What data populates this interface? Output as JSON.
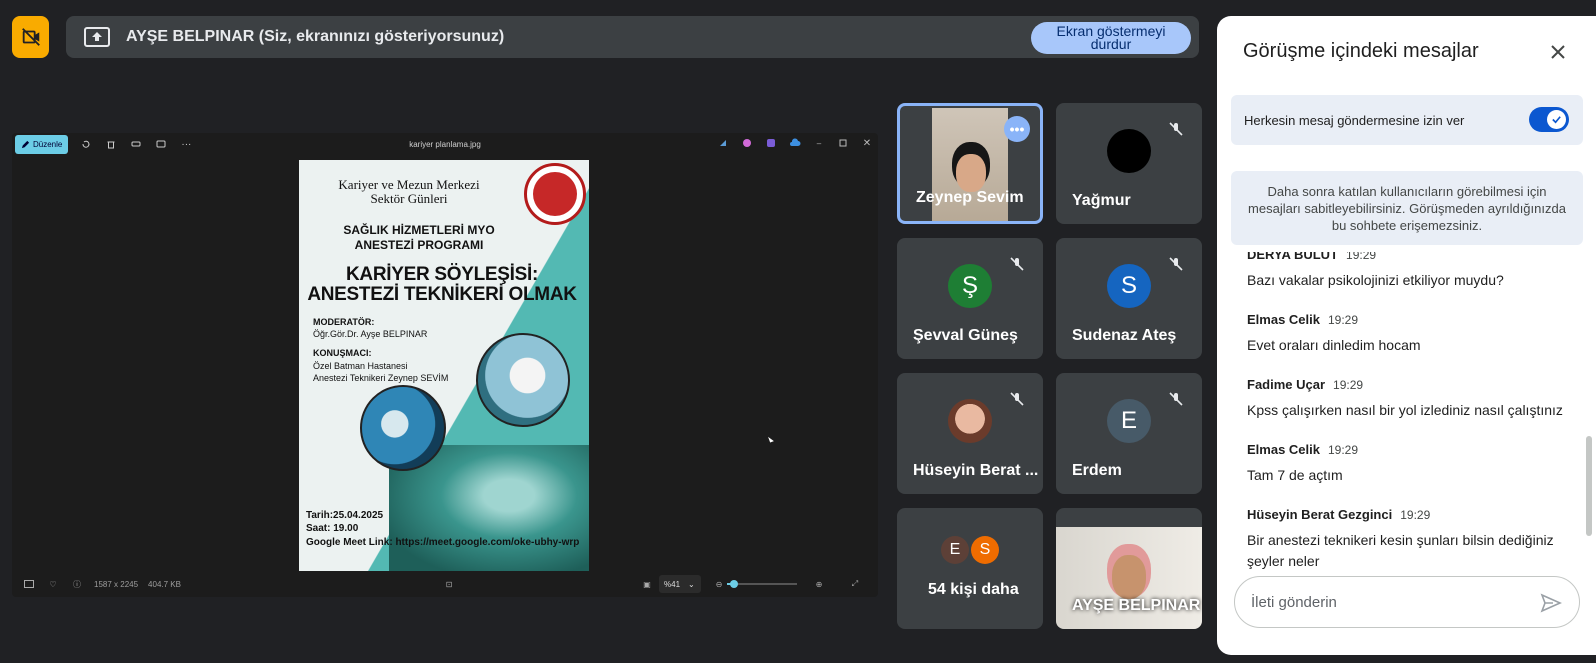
{
  "top": {
    "presenter_text": "AYŞE BELPINAR (Siz, ekranınızı gösteriyorsunuz)",
    "stop_label": "Ekran göstermeyi durdur"
  },
  "photos": {
    "edit_label": "Düzenle",
    "file_name": "kariyer planlama.jpg",
    "dimensions": "1587 x 2245",
    "file_size": "404.7 KB",
    "zoom": "%41"
  },
  "poster": {
    "center": "Kariyer ve Mezun Merkezi Sektör Günleri",
    "program": "SAĞLIK HİZMETLERİ MYO ANESTEZİ PROGRAMI",
    "headline": "KARİYER SÖYLEŞİSİ: ANESTEZİ TEKNİKERİ OLMAK",
    "moderator_label": "MODERATÖR:",
    "moderator": "Öğr.Gör.Dr. Ayşe BELPINAR",
    "speaker_label": "KONUŞMACI:",
    "speaker_org": "Özel Batman Hastanesi",
    "speaker_name": "Anestezi Teknikeri Zeynep SEVİM",
    "date": "Tarih:25.04.2025",
    "time": "Saat: 19.00",
    "link": "Google Meet Link: https://meet.google.com/oke-ubhy-wrp"
  },
  "tiles": [
    {
      "name": "Zeynep Sevim"
    },
    {
      "name": "Yağmur"
    },
    {
      "name": "Şevval Güneş",
      "initial": "Ş",
      "color": "#1e7e34"
    },
    {
      "name": "Sudenaz Ateş",
      "initial": "S",
      "color": "#1565c0"
    },
    {
      "name": "Hüseyin Berat ..."
    },
    {
      "name": "Erdem",
      "initial": "E",
      "color": "#475a68"
    },
    {
      "name": "54 kişi daha",
      "initials": [
        "E",
        "S"
      ],
      "colors": [
        "#5d4037",
        "#ef6c00"
      ]
    },
    {
      "name": "AYŞE BELPINAR"
    }
  ],
  "chat": {
    "title": "Görüşme içindeki mesajlar",
    "permission_label": "Herkesin mesaj göndermesine izin ver",
    "info": "Daha sonra katılan kullanıcıların görebilmesi için mesajları sabitleyebilirsiniz. Görüşmeden ayrıldığınızda bu sohbete erişemezsiniz.",
    "messages": [
      {
        "sender": "DERYA BULUT",
        "time": "19:29",
        "text": "Bazı vakalar psikolojinizi etkiliyor muydu?"
      },
      {
        "sender": "Elmas Celik",
        "time": "19:29",
        "text": "Evet oraları dinledim hocam"
      },
      {
        "sender": "Fadime Uçar",
        "time": "19:29",
        "text": "Kpss çalışırken nasıl bir yol izlediniz nasıl çalıştınız"
      },
      {
        "sender": "Elmas Celik",
        "time": "19:29",
        "text": "Tam 7 de açtım"
      },
      {
        "sender": "Hüseyin Berat Gezginci",
        "time": "19:29",
        "text": "Bir anestezi teknikeri kesin şunları bilsin dediğiniz şeyler neler"
      }
    ],
    "input_placeholder": "İleti gönderin"
  }
}
